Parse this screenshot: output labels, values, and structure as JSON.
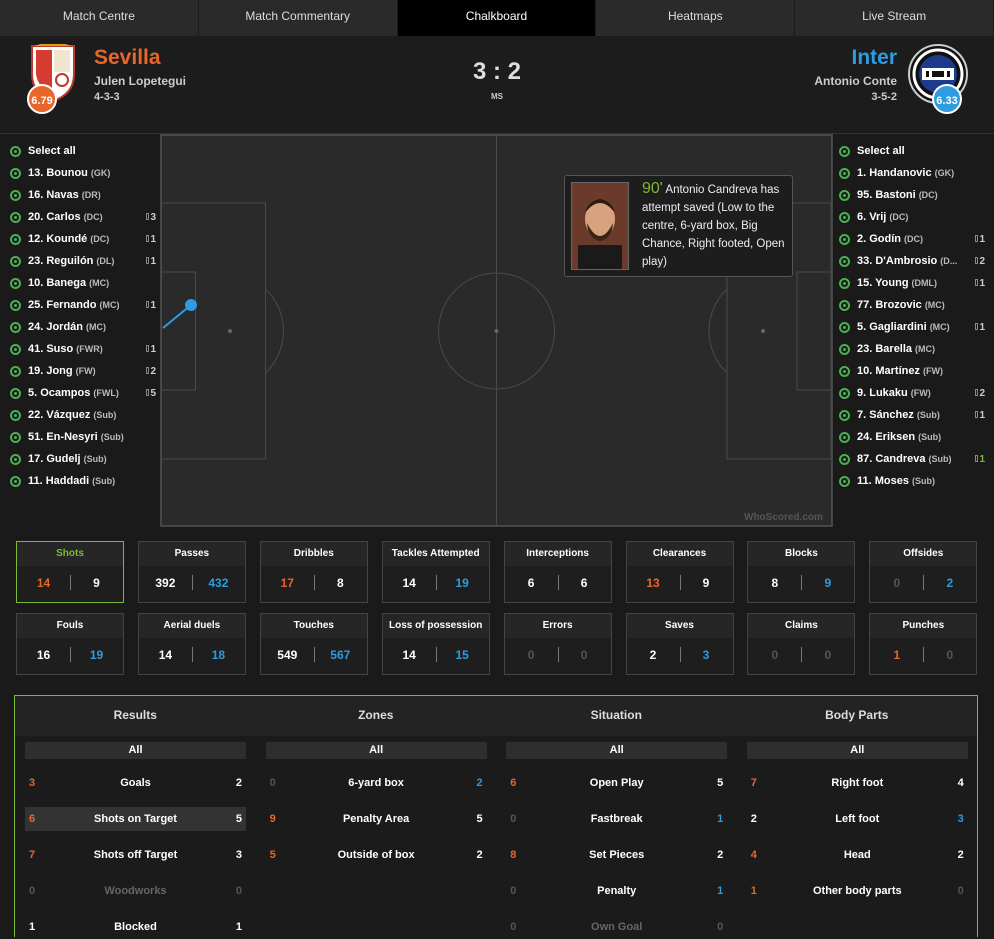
{
  "tabs": [
    "Match Centre",
    "Match Commentary",
    "Chalkboard",
    "Heatmaps",
    "Live Stream"
  ],
  "home": {
    "name": "Sevilla",
    "coach": "Julen Lopetegui",
    "formation": "4-3-3",
    "rating": "6.79",
    "color": "#e8662a"
  },
  "away": {
    "name": "Inter",
    "coach": "Antonio Conte",
    "formation": "3-5-2",
    "rating": "6.33",
    "color": "#2f9be0"
  },
  "score": "3 : 2",
  "status": "MS",
  "select_all": "Select all",
  "home_players": [
    {
      "name": "13. Bounou",
      "pos": "(GK)",
      "count": ""
    },
    {
      "name": "16. Navas",
      "pos": "(DR)",
      "count": ""
    },
    {
      "name": "20. Carlos",
      "pos": "(DC)",
      "count": "3"
    },
    {
      "name": "12. Koundé",
      "pos": "(DC)",
      "count": "1"
    },
    {
      "name": "23. Reguilón",
      "pos": "(DL)",
      "count": "1"
    },
    {
      "name": "10. Banega",
      "pos": "(MC)",
      "count": ""
    },
    {
      "name": "25. Fernando",
      "pos": "(MC)",
      "count": "1"
    },
    {
      "name": "24. Jordán",
      "pos": "(MC)",
      "count": ""
    },
    {
      "name": "41. Suso",
      "pos": "(FWR)",
      "count": "1"
    },
    {
      "name": "19. Jong",
      "pos": "(FW)",
      "count": "2"
    },
    {
      "name": "5. Ocampos",
      "pos": "(FWL)",
      "count": "5"
    },
    {
      "name": "22. Vázquez",
      "pos": "(Sub)",
      "count": ""
    },
    {
      "name": "51. En-Nesyri",
      "pos": "(Sub)",
      "count": ""
    },
    {
      "name": "17. Gudelj",
      "pos": "(Sub)",
      "count": ""
    },
    {
      "name": "11. Haddadi",
      "pos": "(Sub)",
      "count": ""
    }
  ],
  "away_players": [
    {
      "name": "1. Handanovic",
      "pos": "(GK)",
      "count": ""
    },
    {
      "name": "95. Bastoni",
      "pos": "(DC)",
      "count": ""
    },
    {
      "name": "6. Vrij",
      "pos": "(DC)",
      "count": ""
    },
    {
      "name": "2. Godín",
      "pos": "(DC)",
      "count": "1"
    },
    {
      "name": "33. D'Ambrosio",
      "pos": "(D...",
      "count": "2"
    },
    {
      "name": "15. Young",
      "pos": "(DML)",
      "count": "1"
    },
    {
      "name": "77. Brozovic",
      "pos": "(MC)",
      "count": ""
    },
    {
      "name": "5. Gagliardini",
      "pos": "(MC)",
      "count": "1"
    },
    {
      "name": "23. Barella",
      "pos": "(MC)",
      "count": ""
    },
    {
      "name": "10. Martínez",
      "pos": "(FW)",
      "count": ""
    },
    {
      "name": "9. Lukaku",
      "pos": "(FW)",
      "count": "2"
    },
    {
      "name": "7. Sánchez",
      "pos": "(Sub)",
      "count": "1"
    },
    {
      "name": "24. Eriksen",
      "pos": "(Sub)",
      "count": ""
    },
    {
      "name": "87. Candreva",
      "pos": "(Sub)",
      "count": "1"
    },
    {
      "name": "11. Moses",
      "pos": "(Sub)",
      "count": ""
    }
  ],
  "tooltip": {
    "minute": "90'",
    "text": "Antonio Candreva has attempt saved (Low to the centre, 6-yard box, Big Chance, Right footed, Open play)"
  },
  "watermark": "WhoScored.com",
  "stats": [
    {
      "label": "Shots",
      "home": "14",
      "away": "9",
      "hc": "orange",
      "ac": ""
    },
    {
      "label": "Passes",
      "home": "392",
      "away": "432",
      "hc": "",
      "ac": "blue"
    },
    {
      "label": "Dribbles",
      "home": "17",
      "away": "8",
      "hc": "orange",
      "ac": ""
    },
    {
      "label": "Tackles Attempted",
      "home": "14",
      "away": "19",
      "hc": "",
      "ac": "blue"
    },
    {
      "label": "Interceptions",
      "home": "6",
      "away": "6",
      "hc": "",
      "ac": ""
    },
    {
      "label": "Clearances",
      "home": "13",
      "away": "9",
      "hc": "orange",
      "ac": ""
    },
    {
      "label": "Blocks",
      "home": "8",
      "away": "9",
      "hc": "",
      "ac": "blue"
    },
    {
      "label": "Offsides",
      "home": "0",
      "away": "2",
      "hc": "grey",
      "ac": "blue"
    },
    {
      "label": "Fouls",
      "home": "16",
      "away": "19",
      "hc": "",
      "ac": "blue"
    },
    {
      "label": "Aerial duels",
      "home": "14",
      "away": "18",
      "hc": "",
      "ac": "blue"
    },
    {
      "label": "Touches",
      "home": "549",
      "away": "567",
      "hc": "",
      "ac": "blue"
    },
    {
      "label": "Loss of possession",
      "home": "14",
      "away": "15",
      "hc": "",
      "ac": "blue"
    },
    {
      "label": "Errors",
      "home": "0",
      "away": "0",
      "hc": "grey",
      "ac": "grey"
    },
    {
      "label": "Saves",
      "home": "2",
      "away": "3",
      "hc": "",
      "ac": "blue"
    },
    {
      "label": "Claims",
      "home": "0",
      "away": "0",
      "hc": "grey",
      "ac": "grey"
    },
    {
      "label": "Punches",
      "home": "1",
      "away": "0",
      "hc": "orange",
      "ac": "grey"
    }
  ],
  "bottom_tabs": [
    "Results",
    "Zones",
    "Situation",
    "Body Parts"
  ],
  "all_label": "All",
  "columns": [
    [
      {
        "label": "Goals",
        "l": "3",
        "r": "2",
        "lc": "orange",
        "rc": ""
      },
      {
        "label": "Shots on Target",
        "l": "6",
        "r": "5",
        "lc": "orange",
        "rc": "",
        "hl": true
      },
      {
        "label": "Shots off Target",
        "l": "7",
        "r": "3",
        "lc": "orange",
        "rc": ""
      },
      {
        "label": "Woodworks",
        "l": "0",
        "r": "0",
        "lc": "grey",
        "rc": "grey",
        "dim": true
      },
      {
        "label": "Blocked",
        "l": "1",
        "r": "1",
        "lc": "",
        "rc": ""
      }
    ],
    [
      {
        "label": "6-yard box",
        "l": "0",
        "r": "2",
        "lc": "grey",
        "rc": "blue"
      },
      {
        "label": "Penalty Area",
        "l": "9",
        "r": "5",
        "lc": "orange",
        "rc": ""
      },
      {
        "label": "Outside of box",
        "l": "5",
        "r": "2",
        "lc": "orange",
        "rc": ""
      }
    ],
    [
      {
        "label": "Open Play",
        "l": "6",
        "r": "5",
        "lc": "orange",
        "rc": ""
      },
      {
        "label": "Fastbreak",
        "l": "0",
        "r": "1",
        "lc": "grey",
        "rc": "blue"
      },
      {
        "label": "Set Pieces",
        "l": "8",
        "r": "2",
        "lc": "orange",
        "rc": ""
      },
      {
        "label": "Penalty",
        "l": "0",
        "r": "1",
        "lc": "grey",
        "rc": "blue"
      },
      {
        "label": "Own Goal",
        "l": "0",
        "r": "0",
        "lc": "grey",
        "rc": "grey",
        "dim": true
      }
    ],
    [
      {
        "label": "Right foot",
        "l": "7",
        "r": "4",
        "lc": "orange",
        "rc": ""
      },
      {
        "label": "Left foot",
        "l": "2",
        "r": "3",
        "lc": "",
        "rc": "blue"
      },
      {
        "label": "Head",
        "l": "4",
        "r": "2",
        "lc": "orange",
        "rc": ""
      },
      {
        "label": "Other body parts",
        "l": "1",
        "r": "0",
        "lc": "orange",
        "rc": "grey"
      }
    ]
  ]
}
